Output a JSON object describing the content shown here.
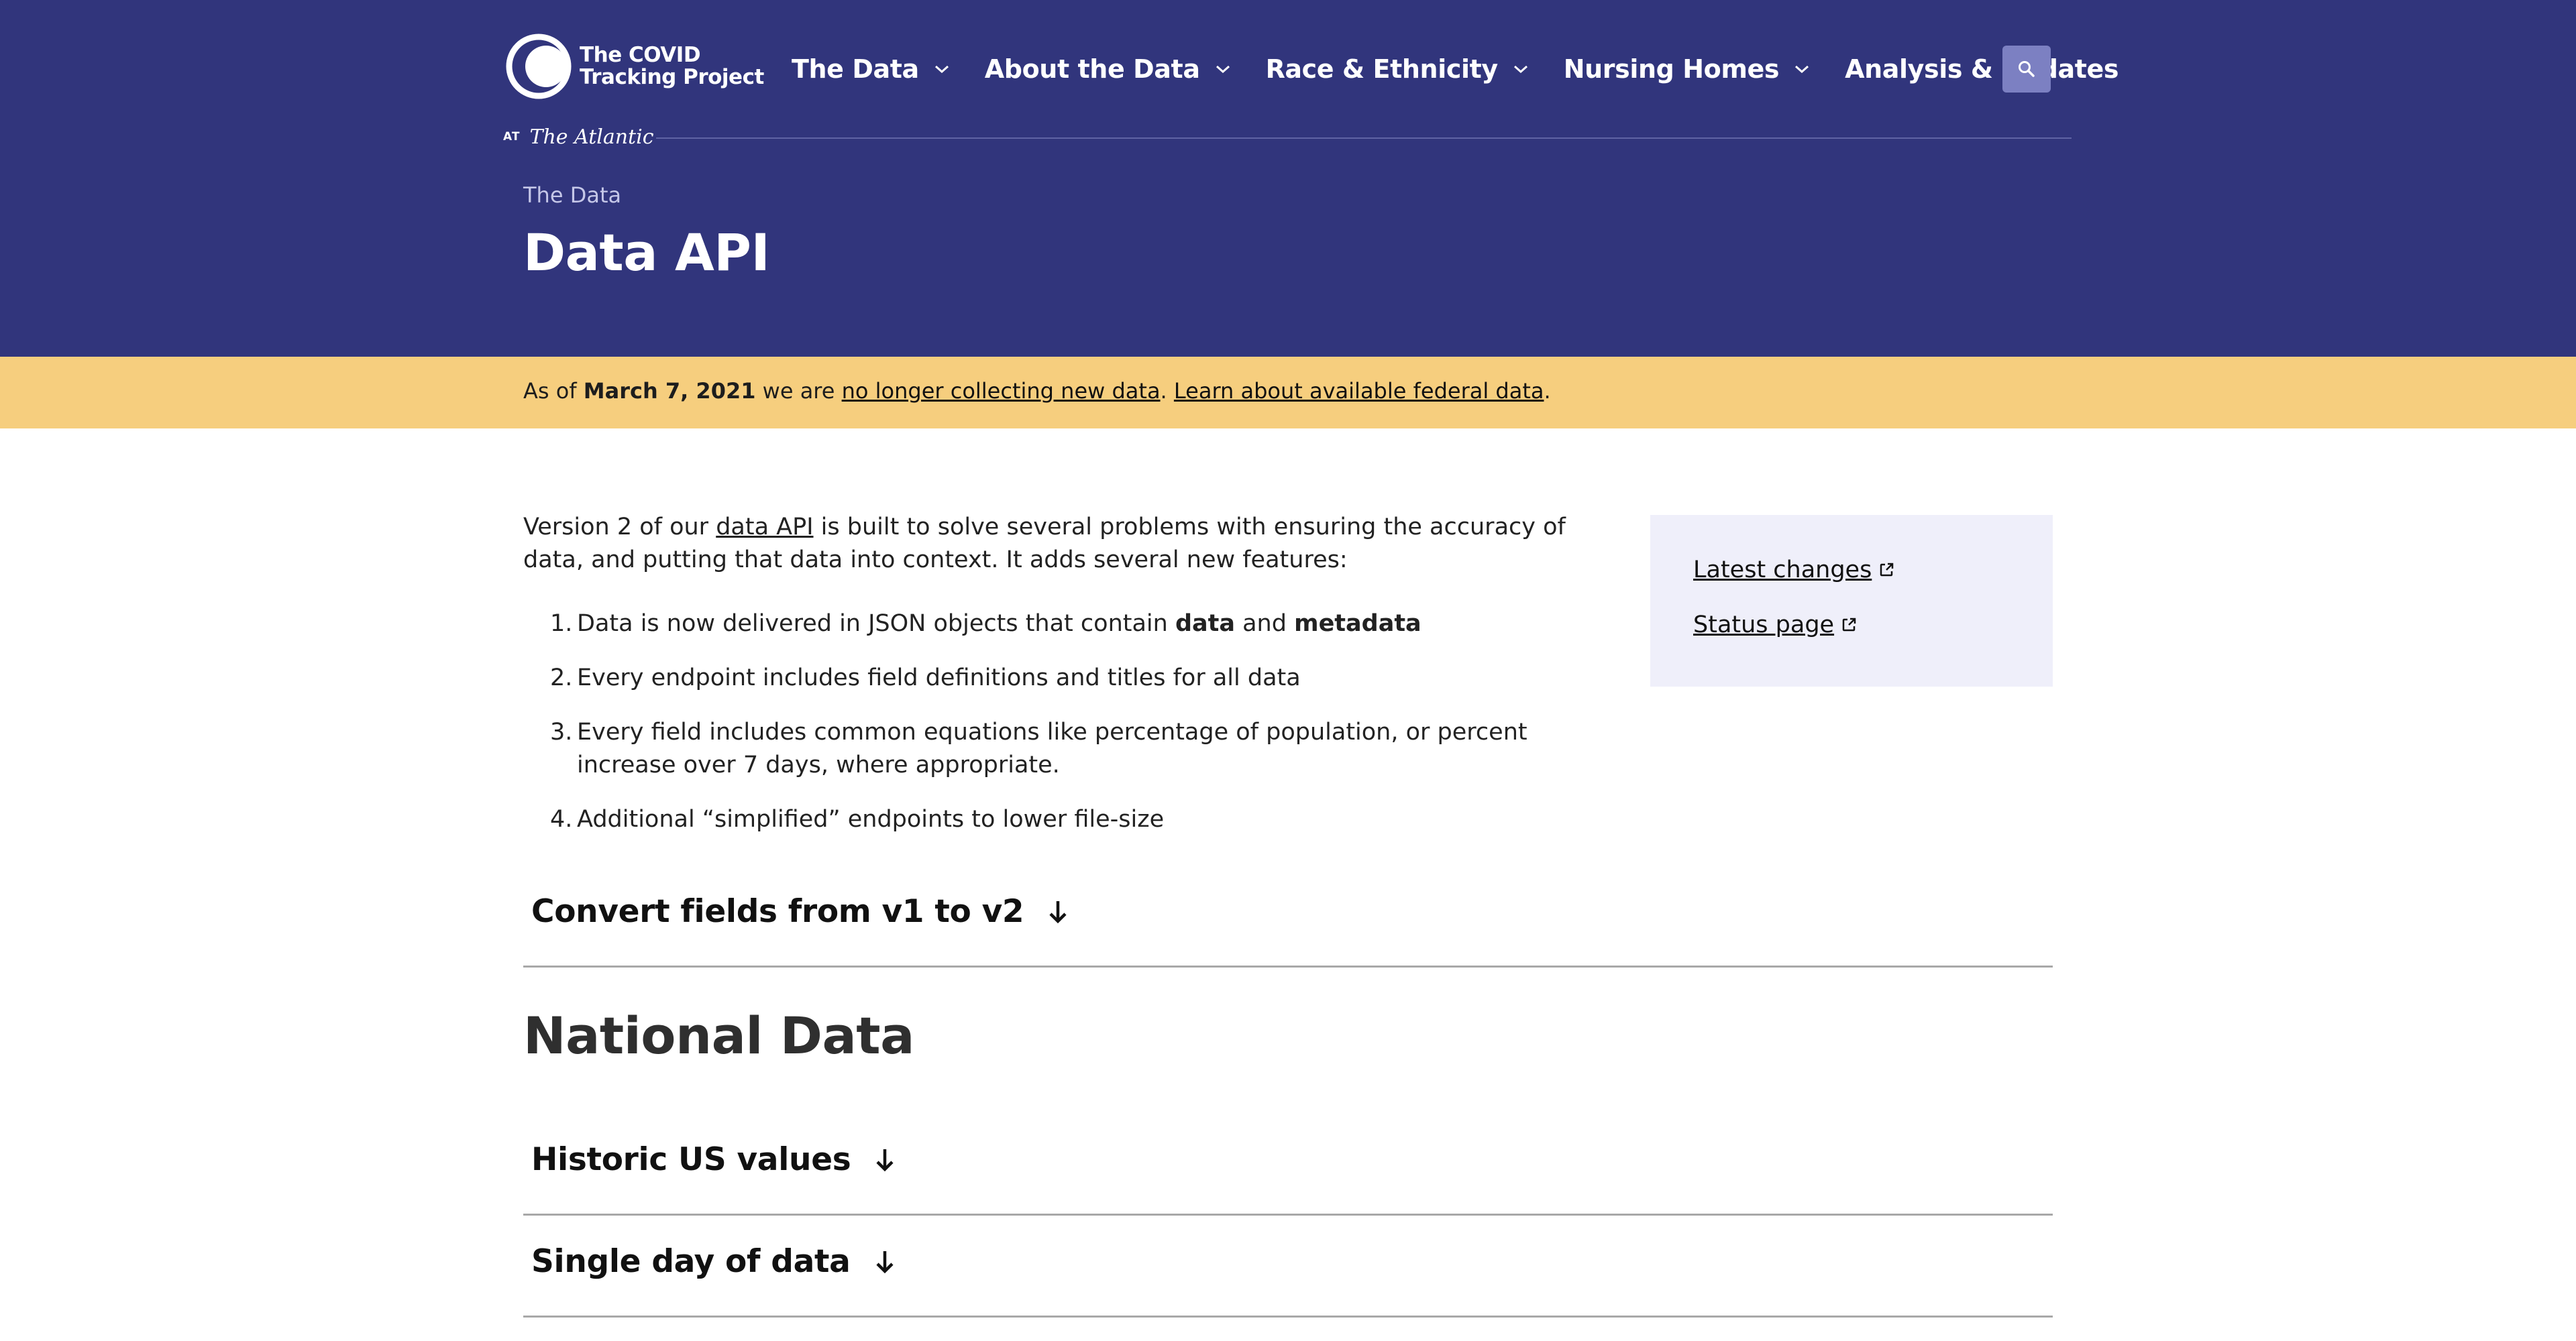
{
  "brand": {
    "name_line1": "The COVID",
    "name_line2": "Tracking Project",
    "at_label": "AT",
    "publisher": "The Atlantic"
  },
  "nav": {
    "items": [
      {
        "label": "The Data",
        "has_dropdown": true
      },
      {
        "label": "About the Data",
        "has_dropdown": true
      },
      {
        "label": "Race & Ethnicity",
        "has_dropdown": true
      },
      {
        "label": "Nursing Homes",
        "has_dropdown": true
      },
      {
        "label": "Analysis & Updates",
        "has_dropdown": false
      }
    ],
    "search_icon": "search-icon"
  },
  "page": {
    "breadcrumb": "The Data",
    "title": "Data API"
  },
  "notice": {
    "prefix": "As of ",
    "date": "March 7, 2021",
    "middle": " we are ",
    "link1": "no longer collecting new data",
    "sep": ". ",
    "link2": "Learn about available federal data",
    "suffix": "."
  },
  "intro": {
    "part1": "Version 2 of our ",
    "link": "data API",
    "part2": " is built to solve several problems with ensuring the accuracy of data, and putting that data into context. It adds several new features:"
  },
  "features": [
    {
      "num": "1.",
      "pre": "Data is now delivered in JSON objects that contain ",
      "bold1": "data",
      "mid": " and ",
      "bold2": "metadata"
    },
    {
      "num": "2.",
      "text": "Every endpoint includes field definitions and titles for all data"
    },
    {
      "num": "3.",
      "text": "Every field includes common equations like percentage of population, or percent increase over 7 days, where appropriate."
    },
    {
      "num": "4.",
      "text": "Additional “simplified” endpoints to lower file-size"
    }
  ],
  "sidebar": {
    "links": [
      "Latest changes",
      "Status page"
    ]
  },
  "sections": {
    "convert": "Convert fields from v1 to v2",
    "national_heading": "National Data",
    "historic": "Historic US values",
    "single_day": "Single day of data"
  },
  "colors": {
    "header_bg": "#31357c",
    "notice_bg": "#f6ce7e",
    "sidebar_bg": "#efeffa",
    "search_bg": "#7c80c2"
  }
}
